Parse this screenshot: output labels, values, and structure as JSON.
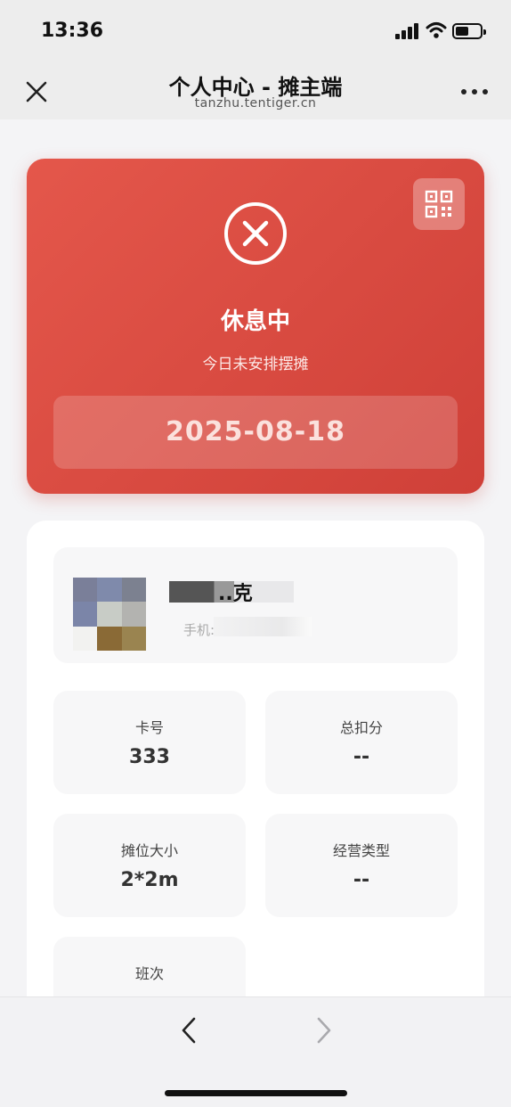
{
  "status_bar": {
    "time": "13:36"
  },
  "nav": {
    "title": "个人中心 - 摊主端",
    "subtitle": "tanzhu.tentiger.cn"
  },
  "status_card": {
    "title": "休息中",
    "subtitle": "今日未安排摆摊",
    "date": "2025-08-18",
    "accent_color": "#d94a40"
  },
  "profile": {
    "name_visible": "..克",
    "phone_prefix": "手机: 1"
  },
  "stats": [
    {
      "label": "卡号",
      "value": "333"
    },
    {
      "label": "总扣分",
      "value": "--"
    },
    {
      "label": "摊位大小",
      "value": "2*2m"
    },
    {
      "label": "经营类型",
      "value": "--"
    },
    {
      "label": "班次",
      "value": ""
    }
  ],
  "icons": [
    "close-icon",
    "more-icon",
    "qr-code-icon",
    "x-circle-icon",
    "chevron-left-icon",
    "chevron-right-icon"
  ]
}
